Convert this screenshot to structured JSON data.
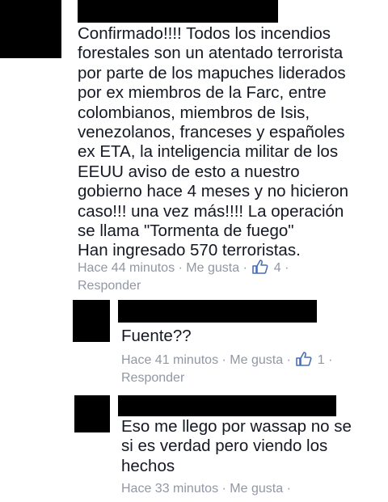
{
  "comments": [
    {
      "lines": [
        "Confirmado!!!! Todos los incendios",
        "forestales son un atentado terrorista",
        "por parte de los mapuches liderados",
        "por ex miembros de la Farc, entre",
        "colombianos, miembros de Isis,",
        "venezolanos, franceses y españoles",
        "ex ETA, la inteligencia militar de los",
        "EEUU aviso de esto a nuestro",
        "gobierno hace 4 meses y no hicieron",
        "caso!!! una vez más!!!! La operación",
        "se llama \"Tormenta de fuego\"",
        "Han ingresado 570 terroristas."
      ],
      "time": "Hace 44 minutos",
      "like": "Me gusta",
      "count": "4",
      "reply": "Responder"
    },
    {
      "lines": [
        "Fuente??"
      ],
      "time": "Hace 41 minutos",
      "like": "Me gusta",
      "count": "1",
      "reply": "Responder"
    },
    {
      "lines": [
        "Eso me llego por wassap no se",
        "si es verdad pero viendo los",
        "hechos"
      ],
      "time": "Hace 33 minutos",
      "like": "Me gusta"
    }
  ],
  "separator": "·",
  "icons": {
    "like": "thumbs-up-icon",
    "like_color": "#4a6fb5"
  }
}
